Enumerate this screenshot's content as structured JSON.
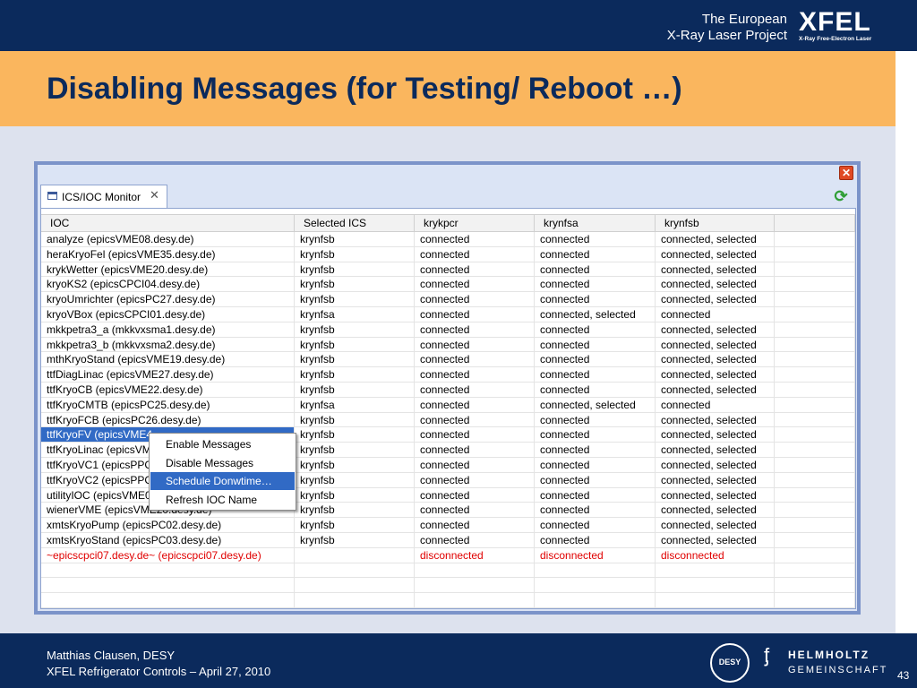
{
  "header": {
    "brand_line1": "The European",
    "brand_line2": "X-Ray Laser Project",
    "logo_word": "XFEL",
    "logo_sub": "X-Ray Free-Electron Laser"
  },
  "slide": {
    "title": "Disabling Messages (for Testing/ Reboot …)"
  },
  "window": {
    "tab_label": "ICS/IOC Monitor",
    "columns": [
      "IOC",
      "Selected ICS",
      "krykpcr",
      "krynfsa",
      "krynfsb",
      ""
    ],
    "rows": [
      [
        "analyze (epicsVME08.desy.de)",
        "krynfsb",
        "connected",
        "connected",
        "connected, selected"
      ],
      [
        "heraKryoFel (epicsVME35.desy.de)",
        "krynfsb",
        "connected",
        "connected",
        "connected, selected"
      ],
      [
        "krykWetter (epicsVME20.desy.de)",
        "krynfsb",
        "connected",
        "connected",
        "connected, selected"
      ],
      [
        "kryoKS2 (epicsCPCI04.desy.de)",
        "krynfsb",
        "connected",
        "connected",
        "connected, selected"
      ],
      [
        "kryoUmrichter (epicsPC27.desy.de)",
        "krynfsb",
        "connected",
        "connected",
        "connected, selected"
      ],
      [
        "kryoVBox (epicsCPCI01.desy.de)",
        "krynfsa",
        "connected",
        "connected, selected",
        "connected"
      ],
      [
        "mkkpetra3_a (mkkvxsma1.desy.de)",
        "krynfsb",
        "connected",
        "connected",
        "connected, selected"
      ],
      [
        "mkkpetra3_b (mkkvxsma2.desy.de)",
        "krynfsb",
        "connected",
        "connected",
        "connected, selected"
      ],
      [
        "mthKryoStand (epicsVME19.desy.de)",
        "krynfsb",
        "connected",
        "connected",
        "connected, selected"
      ],
      [
        "ttfDiagLinac (epicsVME27.desy.de)",
        "krynfsb",
        "connected",
        "connected",
        "connected, selected"
      ],
      [
        "ttfKryoCB (epicsVME22.desy.de)",
        "krynfsb",
        "connected",
        "connected",
        "connected, selected"
      ],
      [
        "ttfKryoCMTB (epicsPC25.desy.de)",
        "krynfsa",
        "connected",
        "connected, selected",
        "connected"
      ],
      [
        "ttfKryoFCB (epicsPC26.desy.de)",
        "krynfsb",
        "connected",
        "connected",
        "connected, selected"
      ],
      [
        "ttfKryoFV (epicsVME4",
        "krynfsb",
        "connected",
        "connected",
        "connected, selected"
      ],
      [
        "ttfKryoLinac (epicsVM",
        "krynfsb",
        "connected",
        "connected",
        "connected, selected"
      ],
      [
        "ttfKryoVC1 (epicsPPC",
        "krynfsb",
        "connected",
        "connected",
        "connected, selected"
      ],
      [
        "ttfKryoVC2 (epicsPPC",
        "krynfsb",
        "connected",
        "connected",
        "connected, selected"
      ],
      [
        "utilityIOC (epicsVME0",
        "krynfsb",
        "connected",
        "connected",
        "connected, selected"
      ],
      [
        "wienerVME (epicsVME20.desy.de)",
        "krynfsb",
        "connected",
        "connected",
        "connected, selected"
      ],
      [
        "xmtsKryoPump (epicsPC02.desy.de)",
        "krynfsb",
        "connected",
        "connected",
        "connected, selected"
      ],
      [
        "xmtsKryoStand (epicsPC03.desy.de)",
        "krynfsb",
        "connected",
        "connected",
        "connected, selected"
      ],
      [
        "~epicscpci07.desy.de~ (epicscpci07.desy.de)",
        "",
        "disconnected",
        "disconnected",
        "disconnected"
      ],
      [
        "",
        "",
        "",
        "",
        ""
      ],
      [
        "",
        "",
        "",
        "",
        ""
      ],
      [
        "",
        "",
        "",
        "",
        ""
      ]
    ],
    "selected_row": 13,
    "disconnected_row": 21,
    "context_menu": [
      "Enable Messages",
      "Disable Messages",
      "Schedule Donwtime…",
      "Refresh IOC Name"
    ],
    "context_highlight": 2
  },
  "footer": {
    "author": "Matthias Clausen, DESY",
    "event": "XFEL Refrigerator Controls – April 27, 2010",
    "desy_logo": "DESY",
    "helmholtz_1": "HELMHOLTZ",
    "helmholtz_2": "GEMEINSCHAFT",
    "page": "43"
  },
  "colors": {
    "navy": "#0b2a5c",
    "orange": "#fab65e",
    "selection": "#316ac5",
    "disconnected": "#e00000"
  }
}
